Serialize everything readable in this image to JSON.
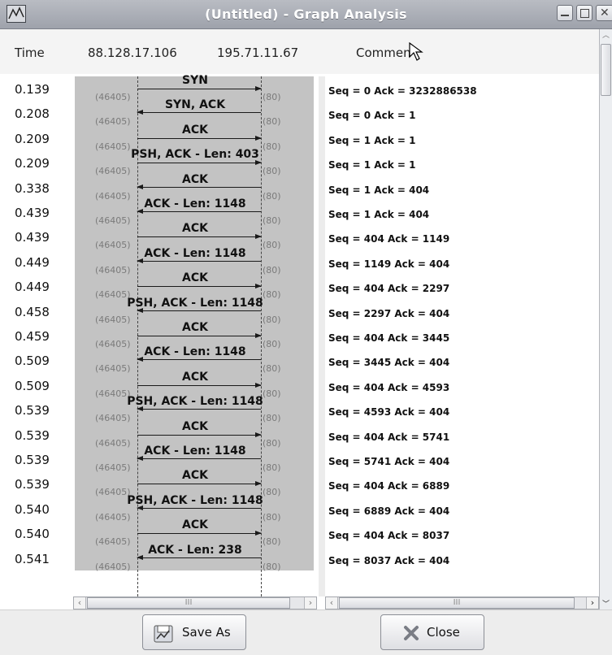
{
  "window": {
    "title": "(Untitled) - Graph Analysis"
  },
  "header": {
    "time": "Time",
    "host_a": "88.128.17.106",
    "host_b": "195.71.11.67",
    "comment": "Comment"
  },
  "ports": {
    "left": "(46405)",
    "right": "(80)"
  },
  "rows": [
    {
      "time": "0.139",
      "label": "SYN",
      "dir": "r",
      "comment": "Seq = 0 Ack = 3232886538"
    },
    {
      "time": "0.208",
      "label": "SYN, ACK",
      "dir": "l",
      "comment": "Seq = 0 Ack = 1"
    },
    {
      "time": "0.209",
      "label": "ACK",
      "dir": "r",
      "comment": "Seq = 1 Ack = 1"
    },
    {
      "time": "0.209",
      "label": "PSH, ACK - Len: 403",
      "dir": "r",
      "comment": "Seq = 1 Ack = 1"
    },
    {
      "time": "0.338",
      "label": "ACK",
      "dir": "l",
      "comment": "Seq = 1 Ack = 404"
    },
    {
      "time": "0.439",
      "label": "ACK - Len: 1148",
      "dir": "l",
      "comment": "Seq = 1 Ack = 404"
    },
    {
      "time": "0.439",
      "label": "ACK",
      "dir": "r",
      "comment": "Seq = 404 Ack = 1149"
    },
    {
      "time": "0.449",
      "label": "ACK - Len: 1148",
      "dir": "l",
      "comment": "Seq = 1149 Ack = 404"
    },
    {
      "time": "0.449",
      "label": "ACK",
      "dir": "r",
      "comment": "Seq = 404 Ack = 2297"
    },
    {
      "time": "0.458",
      "label": "PSH, ACK - Len: 1148",
      "dir": "l",
      "comment": "Seq = 2297 Ack = 404"
    },
    {
      "time": "0.459",
      "label": "ACK",
      "dir": "r",
      "comment": "Seq = 404 Ack = 3445"
    },
    {
      "time": "0.509",
      "label": "ACK - Len: 1148",
      "dir": "l",
      "comment": "Seq = 3445 Ack = 404"
    },
    {
      "time": "0.509",
      "label": "ACK",
      "dir": "r",
      "comment": "Seq = 404 Ack = 4593"
    },
    {
      "time": "0.539",
      "label": "PSH, ACK - Len: 1148",
      "dir": "l",
      "comment": "Seq = 4593 Ack = 404"
    },
    {
      "time": "0.539",
      "label": "ACK",
      "dir": "r",
      "comment": "Seq = 404 Ack = 5741"
    },
    {
      "time": "0.539",
      "label": "ACK - Len: 1148",
      "dir": "l",
      "comment": "Seq = 5741 Ack = 404"
    },
    {
      "time": "0.539",
      "label": "ACK",
      "dir": "r",
      "comment": "Seq = 404 Ack = 6889"
    },
    {
      "time": "0.540",
      "label": "PSH, ACK - Len: 1148",
      "dir": "l",
      "comment": "Seq = 6889 Ack = 404"
    },
    {
      "time": "0.540",
      "label": "ACK",
      "dir": "r",
      "comment": "Seq = 404 Ack = 8037"
    },
    {
      "time": "0.541",
      "label": "ACK - Len: 238",
      "dir": "l",
      "comment": "Seq = 8037 Ack = 404"
    }
  ],
  "scrollbar": {
    "grip": "III"
  },
  "buttons": {
    "save_as": "Save As",
    "close": "Close"
  }
}
